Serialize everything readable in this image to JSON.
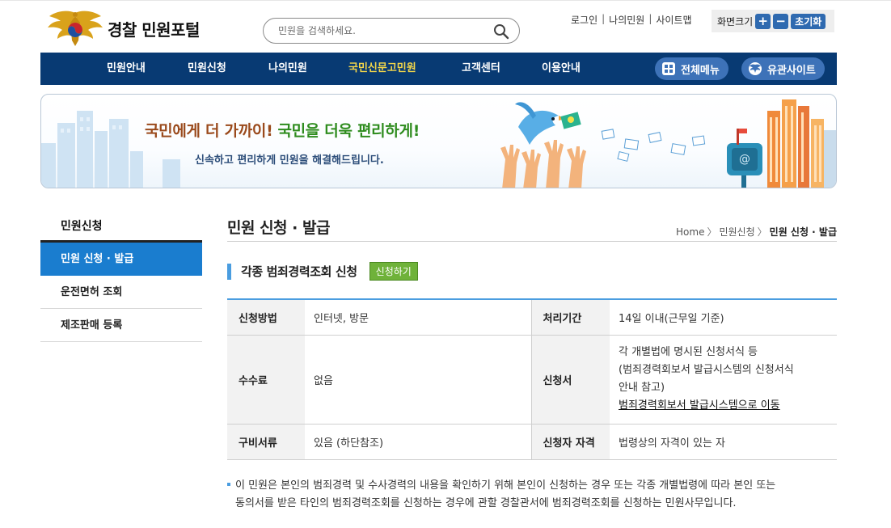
{
  "header": {
    "logo_text": "경찰 민원포털",
    "search_placeholder": "민원을 검색하세요.",
    "util_links": [
      "로그인",
      "나의민원",
      "사이트맵"
    ],
    "font_size": {
      "label": "화면크기",
      "plus": "+",
      "minus": "−",
      "reset": "초기화"
    }
  },
  "nav": {
    "items": [
      "민원안내",
      "민원신청",
      "나의민원",
      "국민신문고민원",
      "고객센터",
      "이용안내"
    ],
    "active_index": 3,
    "all_menu": "전체메뉴",
    "related_sites": "유관사이트"
  },
  "banner": {
    "title_part1": "국민에게 더 가까이!",
    "title_part2": "국민을 더욱 편리하게!",
    "subtitle": "신속하고 편리하게 민원을 해결해드립니다."
  },
  "sidebar": {
    "title": "민원신청",
    "items": [
      "민원 신청 · 발급",
      "운전면허 조회",
      "제조판매 등록"
    ],
    "active_index": 0
  },
  "content": {
    "page_title": "민원 신청 · 발급",
    "breadcrumb": [
      "Home",
      "민원신청",
      "민원 신청 · 발급"
    ],
    "section_title": "각종 범죄경력조회 신청",
    "apply_button": "신청하기",
    "table": {
      "method_label": "신청방법",
      "method_value": "인터넷, 방문",
      "period_label": "처리기간",
      "period_value": "14일 이내(근무일 기준)",
      "fee_label": "수수료",
      "fee_value": "없음",
      "form_label": "신청서",
      "form_lines": [
        "각 개별법에 명시된 신청서식 등",
        "(범죄경력회보서 발급시스템의 신청서식",
        "안내 참고)"
      ],
      "form_link": "범죄경력회보서 발급시스템으로 이동",
      "docs_label": "구비서류",
      "docs_value": "있음 (하단참조)",
      "qual_label": "신청자 자격",
      "qual_value": "법령상의 자격이 있는 자"
    },
    "note_line1": "이 민원은 본인의 범죄경력 및 수사경력의 내용을 확인하기 위해 본인이 신청하는 경우 또는 각종 개별법령에 따라 본인 또는",
    "note_line2": "동의서를 받은 타인의 범죄경력조회를 신청하는 경우에 관할 경찰관서에 범죄경력조회를 신청하는 민원사무입니다."
  },
  "colors": {
    "nav_bg": "#083a73",
    "nav_active": "#f3d64a",
    "accent_blue": "#1a7dcf",
    "apply_green": "#6fb23a"
  }
}
